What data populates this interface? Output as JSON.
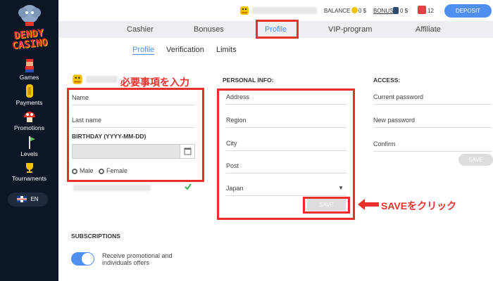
{
  "sidebar": {
    "logo_line1": "DENDY",
    "logo_line2": "CASINO",
    "items": [
      {
        "label": "Games"
      },
      {
        "label": "Payments"
      },
      {
        "label": "Promotions"
      },
      {
        "label": "Levels"
      },
      {
        "label": "Tournaments"
      }
    ],
    "language": "EN"
  },
  "topbar": {
    "balance_label": "BALANCE",
    "balance_value": "0 $",
    "bonus_label": "BONUS",
    "bonus_value": "0 $",
    "gift_count": "12",
    "deposit_label": "DEPOSIT"
  },
  "tabs": [
    {
      "label": "Cashier"
    },
    {
      "label": "Bonuses"
    },
    {
      "label": "Profile"
    },
    {
      "label": "VIP-program"
    },
    {
      "label": "Affiliate"
    }
  ],
  "subtabs": [
    {
      "label": "Profile"
    },
    {
      "label": "Verification"
    },
    {
      "label": "Limits"
    }
  ],
  "annotations": {
    "enter_required": "必要事項を入力",
    "click_save": "SAVEをクリック"
  },
  "personal_left": {
    "name_placeholder": "Name",
    "lastname_placeholder": "Last name",
    "birthday_label": "BIRTHDAY (YYYY-MM-DD)",
    "male_label": "Male",
    "female_label": "Female"
  },
  "personal_info": {
    "title": "PERSONAL INFO:",
    "address": "Address",
    "region": "Region",
    "city": "City",
    "post": "Post",
    "country": "Japan",
    "save_label": "SAVE"
  },
  "access": {
    "title": "ACCESS:",
    "current_password": "Current password",
    "new_password": "New password",
    "confirm": "Confirm",
    "save_label": "SAVE"
  },
  "subscriptions": {
    "title": "SUBSCRIPTIONS",
    "option_text": "Receive promotional and individuals offers"
  },
  "colors": {
    "sidebar_bg": "#0c1626",
    "accent": "#4e8ff0",
    "highlight": "#e8312b"
  }
}
